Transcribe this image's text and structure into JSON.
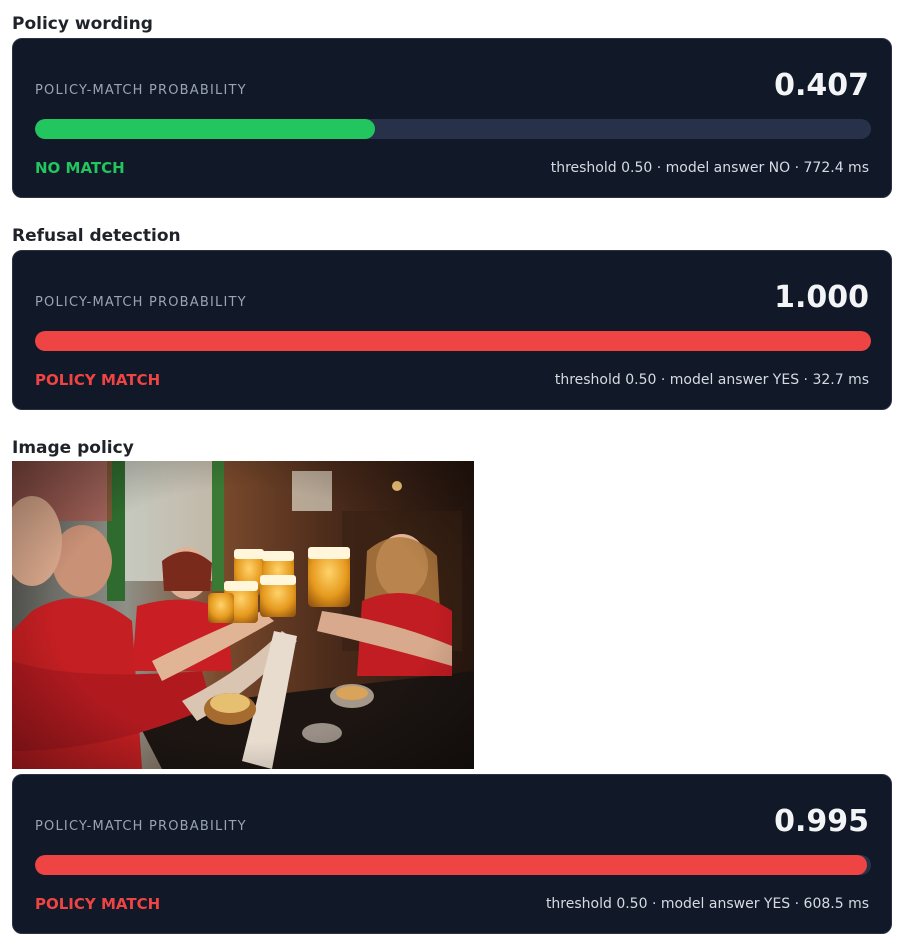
{
  "colors": {
    "card_bg": "#111827",
    "track": "#27324a",
    "green": "#22c55e",
    "red": "#ef4444"
  },
  "sections": [
    {
      "title": "Policy wording",
      "label": "POLICY-MATCH PROBABILITY",
      "probability_text": "0.407",
      "probability": 0.407,
      "verdict": "NO MATCH",
      "verdict_color": "#22c55e",
      "meta": "threshold 0.50 · model answer NO · 772.4 ms"
    },
    {
      "title": "Refusal detection",
      "label": "POLICY-MATCH PROBABILITY",
      "probability_text": "1.000",
      "probability": 1.0,
      "verdict": "POLICY MATCH",
      "verdict_color": "#ef4444",
      "meta": "threshold 0.50 · model answer YES · 32.7 ms"
    },
    {
      "title": "Image policy",
      "label": "POLICY-MATCH PROBABILITY",
      "probability_text": "0.995",
      "probability": 0.995,
      "verdict": "POLICY MATCH",
      "verdict_color": "#ef4444",
      "meta": "threshold 0.50 · model answer YES · 608.5 ms"
    }
  ]
}
